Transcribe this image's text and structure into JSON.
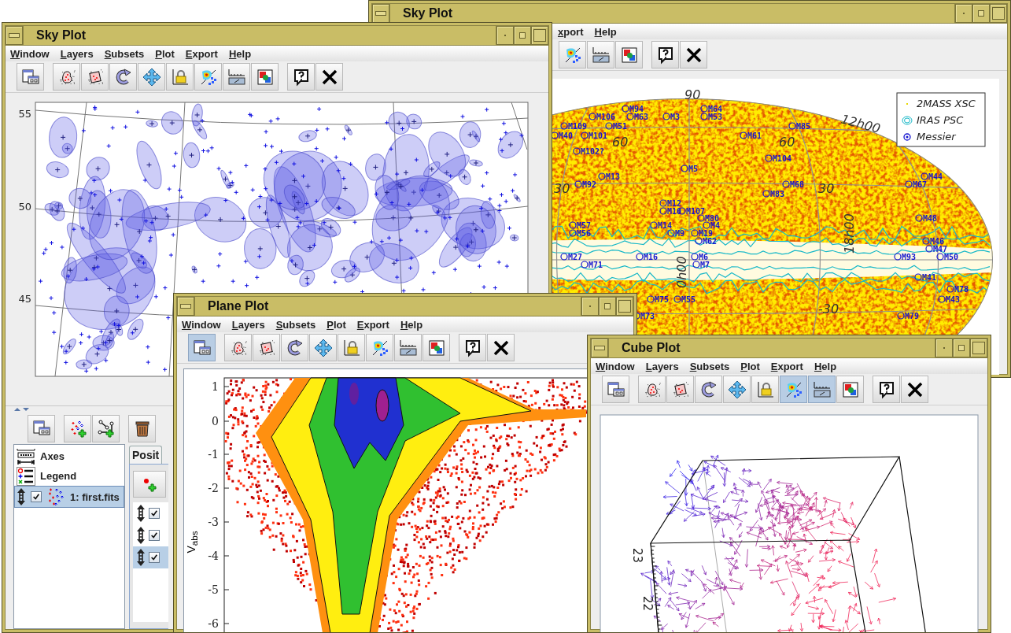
{
  "windows": [
    {
      "kind": "sky-back",
      "title": "Sky Plot",
      "menu": [
        "xport",
        "Help"
      ],
      "toolbar": [
        {
          "kind": "density",
          "selected": false
        },
        {
          "kind": "scale",
          "selected": false
        },
        {
          "kind": "export",
          "selected": false
        },
        {
          "kind": "help",
          "selected": false
        },
        {
          "kind": "close",
          "selected": false
        }
      ],
      "plot": {
        "grid_labels": [
          "90",
          "12h00",
          "60",
          "60",
          "30",
          "30",
          "18h00",
          "0h00",
          "-30"
        ],
        "legend": [
          {
            "kind": "point",
            "label": "2MASS XSC"
          },
          {
            "kind": "rings",
            "label": "IRAS PSC"
          },
          {
            "kind": "circle-dot",
            "label": "Messier"
          }
        ],
        "object_labels": [
          "M94",
          "M64",
          "M106",
          "M63",
          "M3",
          "M53",
          "M109",
          "M51",
          "M85",
          "M40",
          "M101",
          "M61",
          "M102?",
          "M104",
          "M5",
          "M13",
          "M44",
          "M92",
          "M68",
          "M67",
          "M83",
          "M12",
          "M10",
          "M107",
          "M80",
          "M48",
          "M57",
          "M14",
          "M4",
          "M56",
          "M9",
          "M19",
          "M62",
          "M46",
          "M47",
          "M27",
          "M16",
          "M6",
          "M93",
          "M50",
          "M71",
          "M7",
          "M41",
          "M78",
          "M75",
          "M55",
          "M43",
          "M73",
          "M79"
        ]
      }
    },
    {
      "kind": "sky",
      "title": "Sky Plot",
      "menu": [
        "Window",
        "Layers",
        "Subsets",
        "Plot",
        "Export",
        "Help"
      ],
      "toolbar": [
        {
          "kind": "window",
          "selected": false
        },
        {
          "kind": "subset-blob",
          "selected": false
        },
        {
          "kind": "subset-box",
          "selected": false
        },
        {
          "kind": "rotate",
          "selected": false
        },
        {
          "kind": "pan",
          "selected": false
        },
        {
          "kind": "axis-lock",
          "selected": false
        },
        {
          "kind": "density",
          "selected": false
        },
        {
          "kind": "scale",
          "selected": false
        },
        {
          "kind": "export",
          "selected": false
        },
        {
          "kind": "help",
          "selected": false
        },
        {
          "kind": "close",
          "selected": false
        }
      ],
      "plot": {
        "y_ticks": [
          "55",
          "50",
          "45"
        ]
      },
      "control_panel": {
        "toolbar": [
          {
            "kind": "window"
          },
          {
            "kind": "add-points"
          },
          {
            "kind": "add-pairs"
          },
          {
            "kind": "delete"
          }
        ],
        "layers": [
          {
            "kind": "axes",
            "label": "Axes",
            "selected": false
          },
          {
            "kind": "legend",
            "label": "Legend",
            "selected": false
          },
          {
            "kind": "table",
            "label": "1: first.fits",
            "checked": true,
            "selected": true
          }
        ],
        "tab": "Posit",
        "subset_rows": [
          {
            "checked": true,
            "selected": false
          },
          {
            "checked": true,
            "selected": false
          },
          {
            "checked": true,
            "selected": true
          }
        ]
      }
    },
    {
      "kind": "plane",
      "title": "Plane Plot",
      "menu": [
        "Window",
        "Layers",
        "Subsets",
        "Plot",
        "Export",
        "Help"
      ],
      "toolbar": [
        {
          "kind": "window",
          "selected": true
        },
        {
          "kind": "subset-blob",
          "selected": false
        },
        {
          "kind": "subset-box",
          "selected": false
        },
        {
          "kind": "rotate",
          "selected": false
        },
        {
          "kind": "pan",
          "selected": false
        },
        {
          "kind": "axis-lock",
          "selected": false
        },
        {
          "kind": "density",
          "selected": false
        },
        {
          "kind": "scale",
          "selected": false
        },
        {
          "kind": "export",
          "selected": false
        },
        {
          "kind": "help",
          "selected": false
        },
        {
          "kind": "close",
          "selected": false
        }
      ],
      "plot": {
        "y_ticks": [
          "1",
          "0",
          "-1",
          "-2",
          "-3",
          "-4",
          "-5",
          "-6"
        ],
        "y_label": "V$_{abs}$"
      }
    },
    {
      "kind": "cube",
      "title": "Cube Plot",
      "menu": [
        "Window",
        "Layers",
        "Subsets",
        "Plot",
        "Export",
        "Help"
      ],
      "toolbar": [
        {
          "kind": "window",
          "selected": false
        },
        {
          "kind": "subset-blob",
          "selected": false
        },
        {
          "kind": "subset-box",
          "selected": false
        },
        {
          "kind": "rotate",
          "selected": false
        },
        {
          "kind": "pan",
          "selected": false
        },
        {
          "kind": "axis-lock",
          "selected": false
        },
        {
          "kind": "density",
          "selected": true
        },
        {
          "kind": "scale",
          "selected": true
        },
        {
          "kind": "export",
          "selected": false
        },
        {
          "kind": "help",
          "selected": false
        },
        {
          "kind": "close",
          "selected": false
        }
      ],
      "plot": {
        "z_ticks": [
          "23",
          "22"
        ]
      }
    }
  ]
}
